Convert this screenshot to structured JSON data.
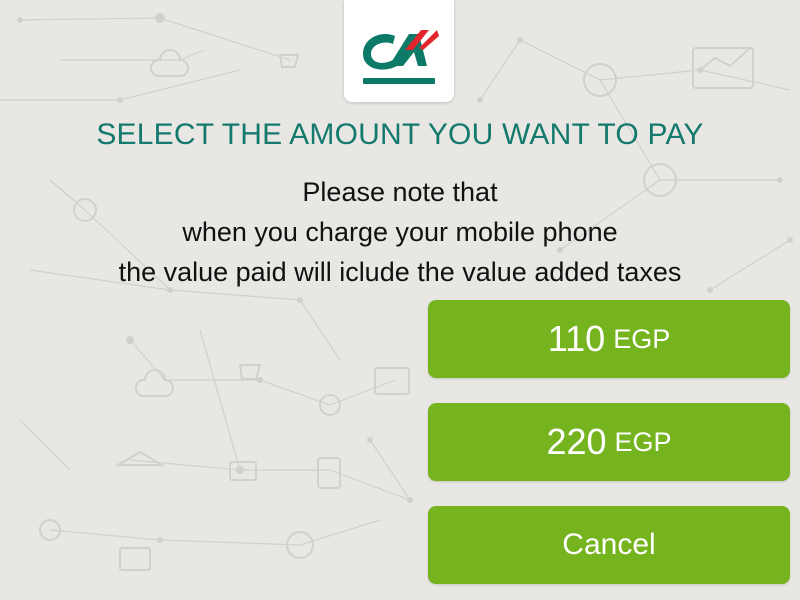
{
  "colors": {
    "background": "#e9e7e3",
    "title": "#157a6e",
    "button": "#76b41f",
    "logo_green": "#0d7a68",
    "logo_red": "#e3262d"
  },
  "logo": {
    "icon": "credit-agricole-logo"
  },
  "title": "SELECT THE AMOUNT YOU WANT TO PAY",
  "note": {
    "lines": [
      "Please note that",
      "when you charge your mobile phone",
      "the value paid will iclude the value added taxes"
    ]
  },
  "options": [
    {
      "amount": "110",
      "currency": "EGP"
    },
    {
      "amount": "220",
      "currency": "EGP"
    }
  ],
  "cancel_label": "Cancel"
}
